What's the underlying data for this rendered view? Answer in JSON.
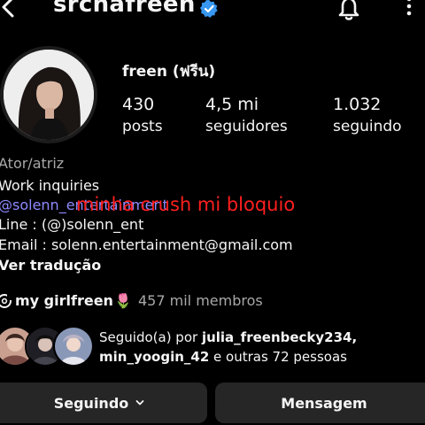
{
  "header": {
    "username": "srchafreen",
    "icons": [
      "back-arrow-icon",
      "verified-badge-icon",
      "bell-icon",
      "more-vertical-icon"
    ]
  },
  "profile": {
    "display_name": "freen (ฟรีน)",
    "stats": {
      "posts_value": "430",
      "posts_label": "posts",
      "followers_value": "4,5 mi",
      "followers_label": "seguidores",
      "following_value": "1.032",
      "following_label": "seguindo"
    }
  },
  "bio": {
    "category": "Ator/atriz",
    "line1": "Work inquiries",
    "line2": "@solenn_entertainment",
    "line3": "Line : (@)solenn_ent",
    "line4": "Email : solenn.entertainment@gmail.com",
    "translate": "Ver tradução",
    "overlay": "minha crush mi bloquio"
  },
  "channel": {
    "name": "my girlfreen",
    "emoji": "🌷",
    "members": "457 mil membros"
  },
  "followed_by": {
    "prefix": "Seguido(a) por ",
    "user1": "julia_freenbecky234,",
    "user2": "min_yoogin_42",
    "middle": " e ",
    "others": "outras 72 pessoas"
  },
  "actions": {
    "following_label": "Seguindo",
    "message_label": "Mensagem"
  },
  "colors": {
    "background": "#000000",
    "button": "#262626",
    "link": "#8f8aff",
    "overlay": "#ff1f1f",
    "verified": "#3897f0"
  }
}
